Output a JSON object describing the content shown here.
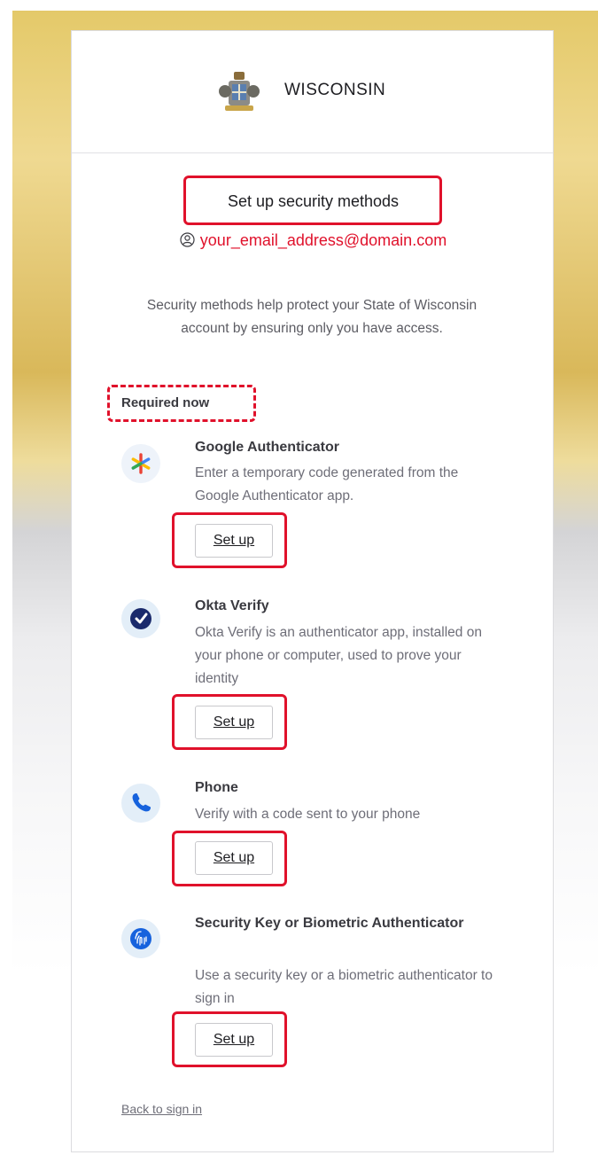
{
  "header": {
    "brand": "WISCONSIN",
    "seal_icon": "state-seal-icon"
  },
  "title": "Set up security methods",
  "user": {
    "email": "your_email_address@domain.com",
    "icon": "user-circle-icon"
  },
  "description": "Security methods help protect your State of Wisconsin account by ensuring only you have access.",
  "section_label": "Required now",
  "methods": [
    {
      "title": "Google Authenticator",
      "description": "Enter a temporary code generated from the Google Authenticator app.",
      "button": "Set up",
      "icon": "google-authenticator-icon"
    },
    {
      "title": "Okta Verify",
      "description": "Okta Verify is an authenticator app, installed on your phone or computer, used to prove your identity",
      "button": "Set up",
      "icon": "okta-verify-icon"
    },
    {
      "title": "Phone",
      "description": "Verify with a code sent to your phone",
      "button": "Set up",
      "icon": "phone-icon"
    },
    {
      "title": "Security Key or Biometric Authenticator",
      "description": "Use a security key or a biometric authenticator to sign in",
      "button": "Set up",
      "icon": "security-key-icon"
    }
  ],
  "back_link": "Back to sign in",
  "colors": {
    "highlight": "#e0112b",
    "icon_bg": "#e3eef8",
    "okta_blue": "#1a2a6c",
    "phone_blue": "#1662dd"
  }
}
